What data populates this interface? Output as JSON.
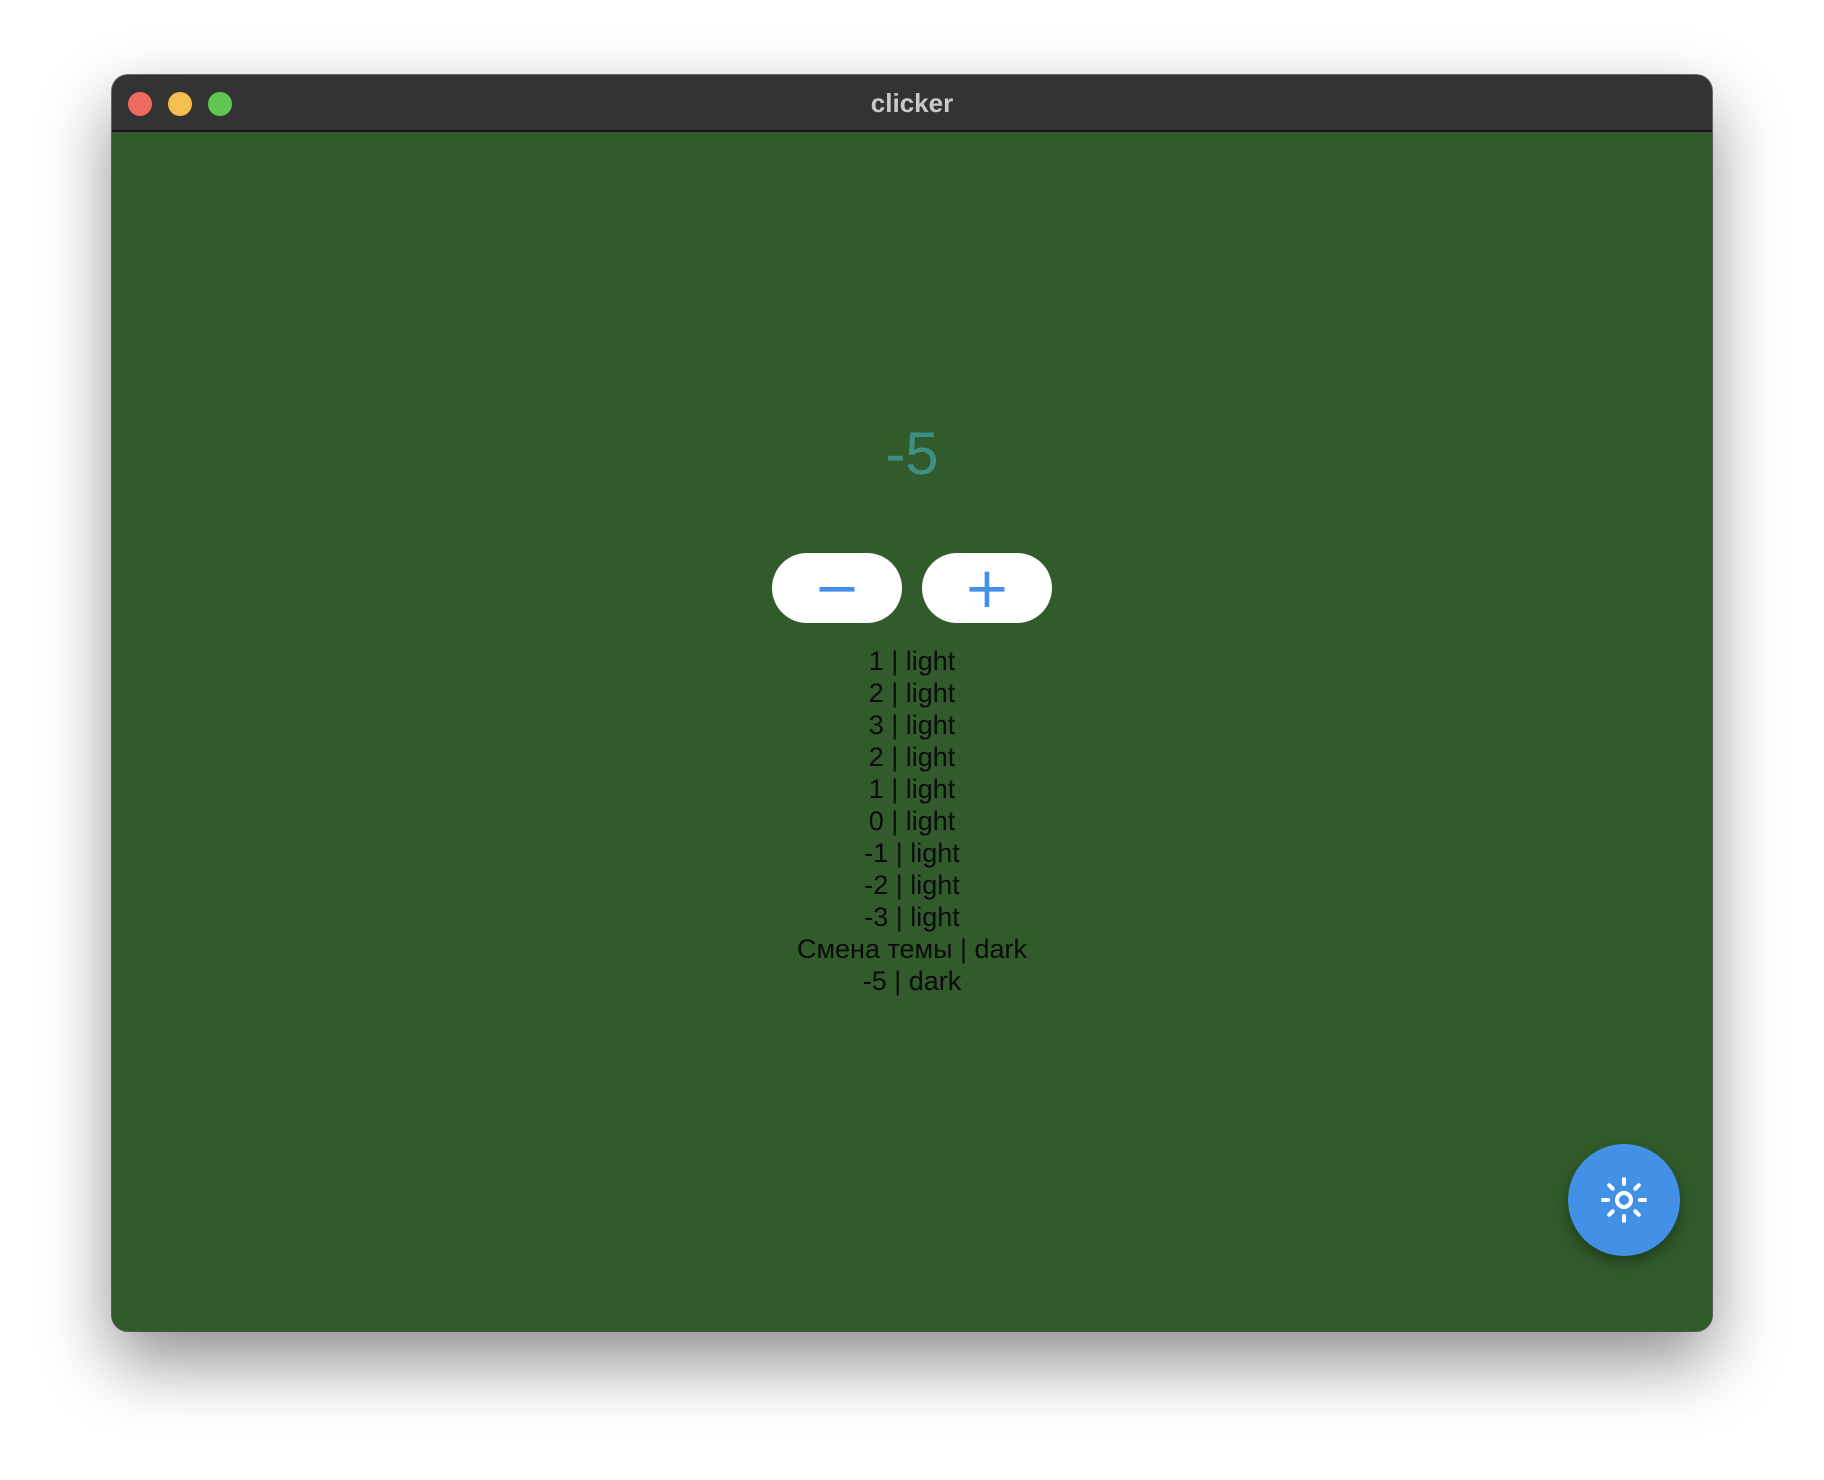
{
  "window": {
    "title": "clicker"
  },
  "counter": {
    "value": "-5"
  },
  "controls": {
    "decrement_label": "−",
    "increment_label": "+"
  },
  "log": {
    "entries": [
      "1 | light",
      "2 | light",
      "3 | light",
      "2 | light",
      "1 | light",
      "0 | light",
      "-1 | light",
      "-2 | light",
      "-3 | light",
      "Смена темы | dark",
      "-5 | dark"
    ]
  },
  "fab": {
    "icon": "sun-icon"
  },
  "colors": {
    "background": "#315b2b",
    "counter_text": "#3e8f86",
    "accent": "#4391e6",
    "titlebar": "#333333"
  }
}
